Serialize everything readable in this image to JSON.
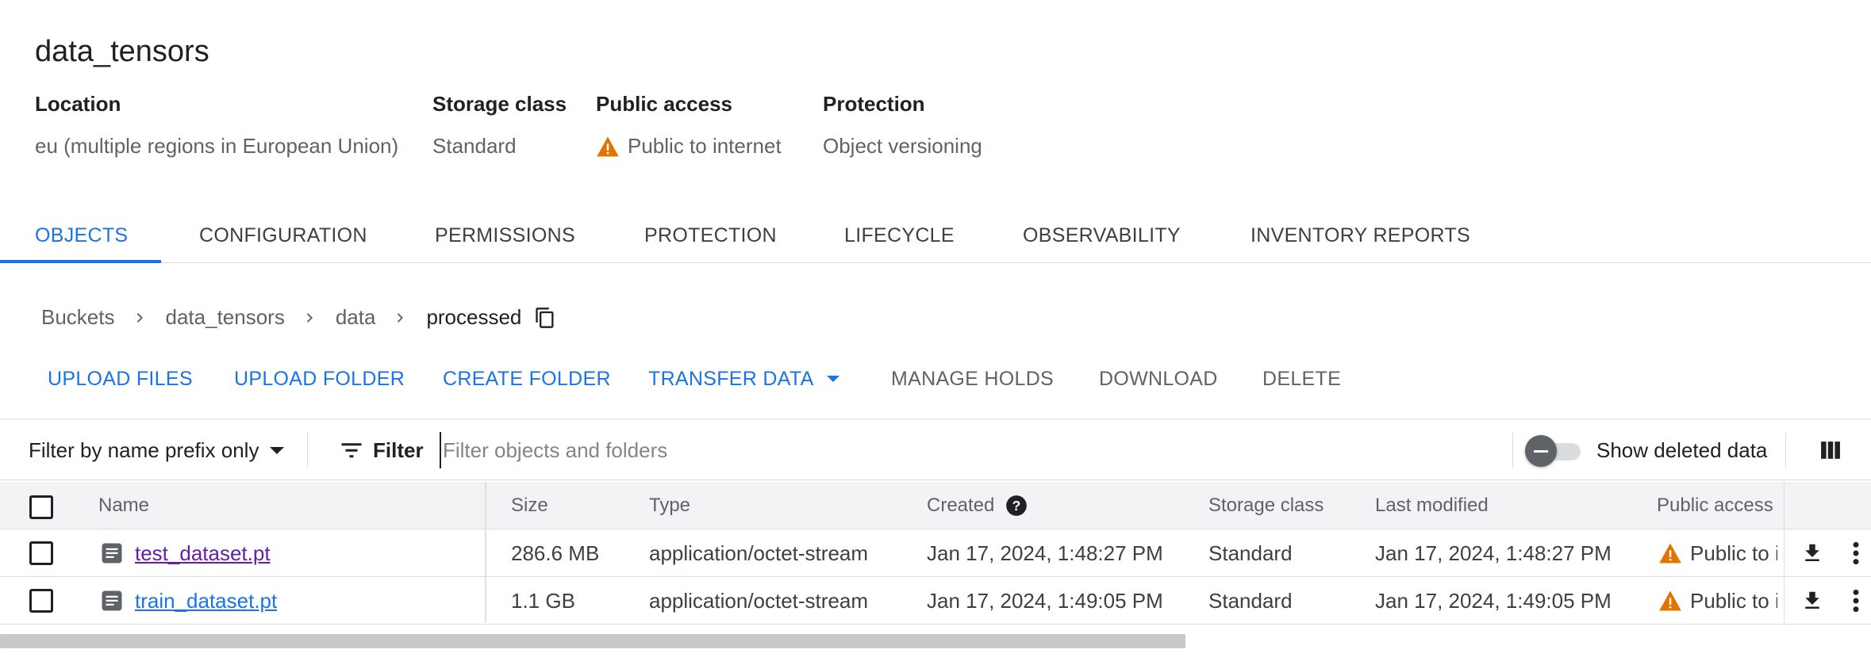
{
  "bucket": {
    "title": "data_tensors"
  },
  "meta": [
    {
      "label": "Location",
      "value": "eu (multiple regions in European Union)"
    },
    {
      "label": "Storage class",
      "value": "Standard"
    },
    {
      "label": "Public access",
      "value": "Public to internet",
      "icon": "warning-icon",
      "icon_color": "#e37400"
    },
    {
      "label": "Protection",
      "value": "Object versioning"
    }
  ],
  "tabs": [
    {
      "label": "OBJECTS",
      "active": true
    },
    {
      "label": "CONFIGURATION"
    },
    {
      "label": "PERMISSIONS"
    },
    {
      "label": "PROTECTION"
    },
    {
      "label": "LIFECYCLE"
    },
    {
      "label": "OBSERVABILITY"
    },
    {
      "label": "INVENTORY REPORTS"
    }
  ],
  "breadcrumb": [
    "Buckets",
    "data_tensors",
    "data",
    "processed"
  ],
  "actions": {
    "upload_files": "UPLOAD FILES",
    "upload_folder": "UPLOAD FOLDER",
    "create_folder": "CREATE FOLDER",
    "transfer_data": "TRANSFER DATA",
    "manage_holds": "MANAGE HOLDS",
    "download": "DOWNLOAD",
    "delete": "DELETE"
  },
  "filter": {
    "prefix_label": "Filter by name prefix only",
    "filter_label": "Filter",
    "placeholder": "Filter objects and folders",
    "show_deleted_label": "Show deleted data",
    "show_deleted": false
  },
  "table": {
    "headers": {
      "name": "Name",
      "size": "Size",
      "type": "Type",
      "created": "Created",
      "storage_class": "Storage class",
      "last_modified": "Last modified",
      "public_access": "Public access"
    },
    "rows": [
      {
        "name": "test_dataset.pt",
        "size": "286.6 MB",
        "type": "application/octet-stream",
        "created": "Jan 17, 2024, 1:48:27 PM",
        "storage_class": "Standard",
        "last_modified": "Jan 17, 2024, 1:48:27 PM",
        "public_access": "Public to internet",
        "visited": true
      },
      {
        "name": "train_dataset.pt",
        "size": "1.1 GB",
        "type": "application/octet-stream",
        "created": "Jan 17, 2024, 1:49:05 PM",
        "storage_class": "Standard",
        "last_modified": "Jan 17, 2024, 1:49:05 PM",
        "public_access": "Public to internet",
        "visited": false
      }
    ]
  },
  "colors": {
    "accent": "#1a73e8",
    "warning": "#e37400",
    "visited_link": "#681da8"
  }
}
